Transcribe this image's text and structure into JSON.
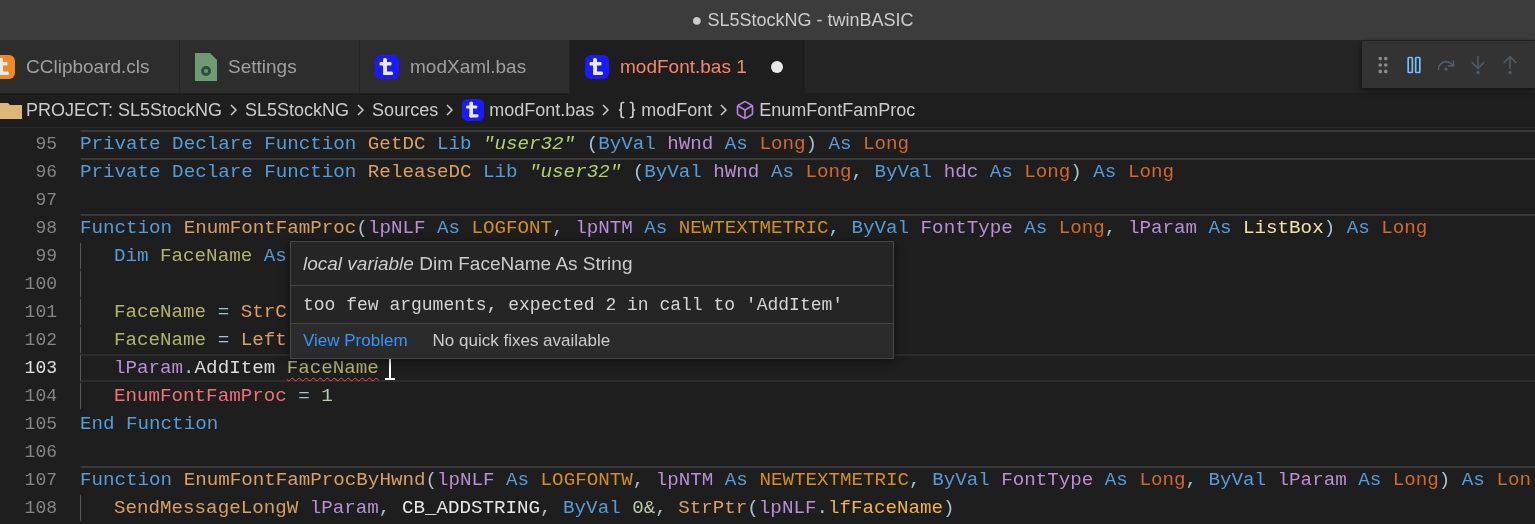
{
  "window": {
    "title": "● SL5StockNG - twinBASIC"
  },
  "tabs": [
    {
      "label": "CClipboard.cls",
      "kind": "class",
      "selected": false,
      "modified": false
    },
    {
      "label": "Settings",
      "kind": "settings",
      "selected": false,
      "modified": false
    },
    {
      "label": "modXaml.bas",
      "kind": "module",
      "selected": false,
      "modified": false
    },
    {
      "label": "modFont.bas",
      "problems": "1",
      "kind": "module",
      "selected": true,
      "modified": true
    }
  ],
  "debug_toolbar": {
    "buttons": [
      {
        "kind": "pause",
        "disabled": false
      },
      {
        "kind": "step-over",
        "disabled": true
      },
      {
        "kind": "step-into",
        "disabled": true
      },
      {
        "kind": "step-out",
        "disabled": true
      }
    ]
  },
  "breadcrumb": [
    {
      "label": "PROJECT: SL5StockNG",
      "kind": "folder"
    },
    {
      "label": "SL5StockNG",
      "kind": "plain"
    },
    {
      "label": "Sources",
      "kind": "plain"
    },
    {
      "label": "modFont.bas",
      "kind": "module"
    },
    {
      "label": "modFont",
      "kind": "namespace"
    },
    {
      "label": "EnumFontFamProc",
      "kind": "method"
    }
  ],
  "editor": {
    "lines": [
      {
        "number": "95",
        "current": false,
        "separator_above": true,
        "indent_guide": false,
        "tokens": [
          {
            "kind": "keyword",
            "text": "Private Declare Function "
          },
          {
            "kind": "function",
            "text": "GetDC"
          },
          {
            "kind": "keyword",
            "text": " Lib "
          },
          {
            "kind": "string",
            "text": "\"user32\""
          },
          {
            "kind": "plain",
            "text": " ("
          },
          {
            "kind": "keyword",
            "text": "ByVal "
          },
          {
            "kind": "param",
            "text": "hWnd"
          },
          {
            "kind": "keyword",
            "text": " As "
          },
          {
            "kind": "type",
            "text": "Long"
          },
          {
            "kind": "plain",
            "text": ") "
          },
          {
            "kind": "keyword",
            "text": "As "
          },
          {
            "kind": "type",
            "text": "Long"
          }
        ]
      },
      {
        "number": "96",
        "current": false,
        "separator_above": true,
        "indent_guide": false,
        "tokens": [
          {
            "kind": "keyword",
            "text": "Private Declare Function "
          },
          {
            "kind": "function",
            "text": "ReleaseDC"
          },
          {
            "kind": "keyword",
            "text": " Lib "
          },
          {
            "kind": "string",
            "text": "\"user32\""
          },
          {
            "kind": "plain",
            "text": " ("
          },
          {
            "kind": "keyword",
            "text": "ByVal "
          },
          {
            "kind": "param",
            "text": "hWnd"
          },
          {
            "kind": "keyword",
            "text": " As "
          },
          {
            "kind": "type",
            "text": "Long"
          },
          {
            "kind": "plain",
            "text": ", "
          },
          {
            "kind": "keyword",
            "text": "ByVal "
          },
          {
            "kind": "param",
            "text": "hdc"
          },
          {
            "kind": "keyword",
            "text": " As "
          },
          {
            "kind": "type",
            "text": "Long"
          },
          {
            "kind": "plain",
            "text": ") "
          },
          {
            "kind": "keyword",
            "text": "As "
          },
          {
            "kind": "type",
            "text": "Long"
          }
        ]
      },
      {
        "number": "97",
        "current": false,
        "separator_above": false,
        "indent_guide": false
      },
      {
        "number": "98",
        "current": false,
        "separator_above": true,
        "indent_guide": false,
        "tokens": [
          {
            "kind": "keyword",
            "text": "Function "
          },
          {
            "kind": "function",
            "text": "EnumFontFamProc"
          },
          {
            "kind": "plain",
            "text": "("
          },
          {
            "kind": "param",
            "text": "lpNLF"
          },
          {
            "kind": "keyword",
            "text": " As "
          },
          {
            "kind": "udt",
            "text": "LOGFONT"
          },
          {
            "kind": "plain",
            "text": ", "
          },
          {
            "kind": "param",
            "text": "lpNTM"
          },
          {
            "kind": "keyword",
            "text": " As "
          },
          {
            "kind": "udt",
            "text": "NEWTEXTMETRIC"
          },
          {
            "kind": "plain",
            "text": ", "
          },
          {
            "kind": "keyword",
            "text": "ByVal "
          },
          {
            "kind": "param",
            "text": "FontType"
          },
          {
            "kind": "keyword",
            "text": " As "
          },
          {
            "kind": "type",
            "text": "Long"
          },
          {
            "kind": "plain",
            "text": ", "
          },
          {
            "kind": "param",
            "text": "lParam"
          },
          {
            "kind": "keyword",
            "text": " As "
          },
          {
            "kind": "class",
            "text": "ListBox"
          },
          {
            "kind": "plain",
            "text": ") "
          },
          {
            "kind": "keyword",
            "text": "As "
          },
          {
            "kind": "type",
            "text": "Long"
          }
        ]
      },
      {
        "number": "99",
        "current": false,
        "separator_above": false,
        "indent_guide": true,
        "tokens": [
          {
            "kind": "keyword",
            "text": "Dim "
          },
          {
            "kind": "variable",
            "text": "FaceName"
          },
          {
            "kind": "keyword",
            "text": " As"
          }
        ]
      },
      {
        "number": "100",
        "current": false,
        "separator_above": false,
        "indent_guide": true
      },
      {
        "number": "101",
        "current": false,
        "separator_above": false,
        "indent_guide": true,
        "tokens": [
          {
            "kind": "variable",
            "text": "FaceName"
          },
          {
            "kind": "plain",
            "text": " = "
          },
          {
            "kind": "function",
            "text": "StrC"
          }
        ]
      },
      {
        "number": "102",
        "current": false,
        "separator_above": false,
        "indent_guide": true,
        "tokens": [
          {
            "kind": "variable",
            "text": "FaceName"
          },
          {
            "kind": "plain",
            "text": " = "
          },
          {
            "kind": "function",
            "text": "Left"
          }
        ]
      },
      {
        "number": "103",
        "current": true,
        "separator_above": false,
        "indent_guide": true,
        "tokens": [
          {
            "kind": "param",
            "text": "lParam"
          },
          {
            "kind": "plain",
            "text": "."
          },
          {
            "kind": "method",
            "text": "AddItem "
          },
          {
            "kind": "variable",
            "text": "FaceName",
            "error": true
          }
        ]
      },
      {
        "number": "104",
        "current": false,
        "separator_above": false,
        "indent_guide": true,
        "tokens": [
          {
            "kind": "retval",
            "text": "EnumFontFamProc"
          },
          {
            "kind": "plain",
            "text": " = "
          },
          {
            "kind": "number",
            "text": "1"
          }
        ]
      },
      {
        "number": "105",
        "current": false,
        "separator_above": false,
        "indent_guide": false,
        "tokens": [
          {
            "kind": "keyword",
            "text": "End Function"
          }
        ]
      },
      {
        "number": "106",
        "current": false,
        "separator_above": false,
        "indent_guide": false
      },
      {
        "number": "107",
        "current": false,
        "separator_above": true,
        "indent_guide": false,
        "tokens": [
          {
            "kind": "keyword",
            "text": "Function "
          },
          {
            "kind": "function",
            "text": "EnumFontFamProcByHwnd"
          },
          {
            "kind": "plain",
            "text": "("
          },
          {
            "kind": "param",
            "text": "lpNLF"
          },
          {
            "kind": "keyword",
            "text": " As "
          },
          {
            "kind": "udt",
            "text": "LOGFONTW"
          },
          {
            "kind": "plain",
            "text": ", "
          },
          {
            "kind": "param",
            "text": "lpNTM"
          },
          {
            "kind": "keyword",
            "text": " As "
          },
          {
            "kind": "udt",
            "text": "NEWTEXTMETRIC"
          },
          {
            "kind": "plain",
            "text": ", "
          },
          {
            "kind": "keyword",
            "text": "ByVal "
          },
          {
            "kind": "param",
            "text": "FontType"
          },
          {
            "kind": "keyword",
            "text": " As "
          },
          {
            "kind": "type",
            "text": "Long"
          },
          {
            "kind": "plain",
            "text": ", "
          },
          {
            "kind": "keyword",
            "text": "ByVal "
          },
          {
            "kind": "param",
            "text": "lParam"
          },
          {
            "kind": "keyword",
            "text": " As "
          },
          {
            "kind": "type",
            "text": "Long"
          },
          {
            "kind": "plain",
            "text": ") "
          },
          {
            "kind": "keyword",
            "text": "As "
          },
          {
            "kind": "type",
            "text": "Lon"
          }
        ]
      },
      {
        "number": "108",
        "current": false,
        "separator_above": false,
        "indent_guide": true,
        "tokens": [
          {
            "kind": "function",
            "text": "SendMessageLongW "
          },
          {
            "kind": "param",
            "text": "lParam"
          },
          {
            "kind": "plain",
            "text": ", "
          },
          {
            "kind": "constant",
            "text": "CB_ADDSTRING"
          },
          {
            "kind": "plain",
            "text": ", "
          },
          {
            "kind": "keyword",
            "text": "ByVal "
          },
          {
            "kind": "number",
            "text": "0&"
          },
          {
            "kind": "plain",
            "text": ", "
          },
          {
            "kind": "function",
            "text": "StrPtr"
          },
          {
            "kind": "plain",
            "text": "("
          },
          {
            "kind": "param",
            "text": "lpNLF"
          },
          {
            "kind": "plain",
            "text": "."
          },
          {
            "kind": "field",
            "text": "lfFaceName"
          },
          {
            "kind": "plain",
            "text": ")"
          }
        ]
      }
    ]
  },
  "hover": {
    "signature": "*local variable* Dim FaceName As String",
    "message": "too few arguments, expected 2 in call to 'AddItem'",
    "link": "View Problem",
    "note": "No quick fixes available"
  }
}
